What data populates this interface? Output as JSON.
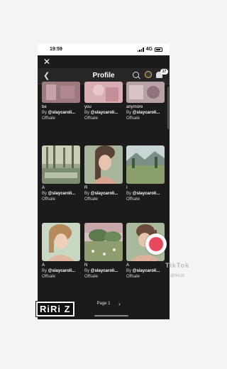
{
  "status_bar": {
    "time": "19:59",
    "network": "4G"
  },
  "header": {
    "title": "Profile",
    "notification_count": "17"
  },
  "top_row": [
    {
      "caption": "be",
      "creator_prefix": "By ",
      "creator": "@slaycaroli...",
      "price": "Offsale"
    },
    {
      "caption": "you",
      "creator_prefix": "By ",
      "creator": "@slaycaroli...",
      "price": "Offsale"
    },
    {
      "caption": "anymore",
      "creator_prefix": "By ",
      "creator": "@slaycaroli...",
      "price": "Offsale"
    }
  ],
  "middle_row": [
    {
      "caption": "A",
      "creator_prefix": "By ",
      "creator": "@slaycaroli...",
      "price": "Offsale"
    },
    {
      "caption": "R",
      "creator_prefix": "By ",
      "creator": "@slaycaroli...",
      "price": "Offsale"
    },
    {
      "caption": "I",
      "creator_prefix": "By ",
      "creator": "@slaycaroli...",
      "price": "Offsale"
    }
  ],
  "bottom_row": [
    {
      "caption": "A",
      "creator_prefix": "By ",
      "creator": "@slaycaroli...",
      "price": "Offsale"
    },
    {
      "caption": "N",
      "creator_prefix": "By ",
      "creator": "@slaycaroli...",
      "price": "Offsale"
    },
    {
      "caption": "A",
      "creator_prefix": "By ",
      "creator": "@slaycaroli...",
      "price": "Offsale"
    }
  ],
  "pager": {
    "label": "Page 1"
  },
  "overlay": {
    "sticker_text": "RiRi Z",
    "tiktok_name": "TikTok",
    "tiktok_user": "@riri.zz"
  },
  "colors": {
    "background": "#1b1b1b",
    "record_button": "#e8475c"
  }
}
